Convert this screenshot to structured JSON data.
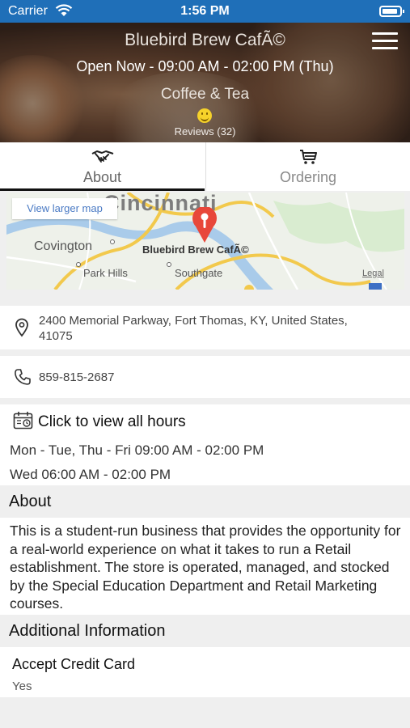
{
  "status_bar": {
    "carrier": "Carrier",
    "time": "1:56 PM"
  },
  "header": {
    "title": "Bluebird Brew CafÃ©",
    "hours": "Open Now - 09:00 AM - 02:00 PM (Thu)",
    "category": "Coffee & Tea",
    "reviews": "Reviews (32)"
  },
  "tabs": [
    {
      "label": "About",
      "icon": "handshake-icon",
      "active": true
    },
    {
      "label": "Ordering",
      "icon": "cart-icon",
      "active": false
    }
  ],
  "map": {
    "view_larger": "View larger map",
    "city": "Cincinnati",
    "labels": {
      "covington": "Covington",
      "park_hills": "Park Hills",
      "southgate": "Southgate"
    },
    "pin_label": "Bluebird Brew CafÃ©",
    "legal": "Legal"
  },
  "contact": {
    "address": "2400 Memorial Parkway, Fort Thomas, KY, United States, 41075",
    "phone": "859-815-2687"
  },
  "hours": {
    "heading": "Click to view all hours",
    "lines": [
      "Mon - Tue, Thu - Fri 09:00 AM - 02:00 PM",
      "Wed 06:00 AM - 02:00 PM"
    ]
  },
  "about": {
    "title": "About",
    "text": "This is a student-run business that provides the opportunity for a real-world experience on what it takes to run a Retail establishment. The store is operated, managed, and stocked by the Special Education Department and Retail Marketing courses."
  },
  "additional": {
    "title": "Additional Information",
    "items": [
      {
        "label": "Accept Credit Card",
        "value": "Yes"
      }
    ]
  },
  "colors": {
    "status_bar": "#1f6fb8",
    "pin": "#e8473a",
    "link": "#4a7ac4"
  }
}
